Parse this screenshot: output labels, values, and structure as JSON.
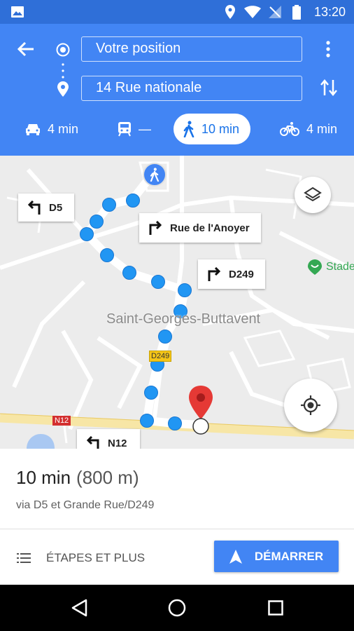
{
  "status_bar": {
    "time": "13:20"
  },
  "header": {
    "origin": "Votre position",
    "destination": "14 Rue nationale",
    "modes": [
      {
        "name": "car",
        "time": "4 min"
      },
      {
        "name": "transit",
        "time": "—"
      },
      {
        "name": "walk",
        "time": "10 min"
      },
      {
        "name": "bike",
        "time": "4 min"
      }
    ],
    "active_mode": "walk"
  },
  "map": {
    "town_label": "Saint-Georges-Buttavent",
    "poi_label": "Stade",
    "road_labels": {
      "d249": "D249",
      "n12": "N12"
    },
    "callouts": {
      "d5": "D5",
      "rue_anoyer": "Rue de l'Anoyer",
      "d249": "D249",
      "n12": "N12"
    }
  },
  "route": {
    "duration": "10 min",
    "distance": "(800 m)",
    "via": "via D5 et Grande Rue/D249"
  },
  "actions": {
    "steps_label": "ÉTAPES ET PLUS",
    "start_label": "DÉMARRER"
  },
  "colors": {
    "primary": "#4285f4",
    "status": "#2f6fd8",
    "route_dot": "#2196f3",
    "pin": "#e53935"
  }
}
